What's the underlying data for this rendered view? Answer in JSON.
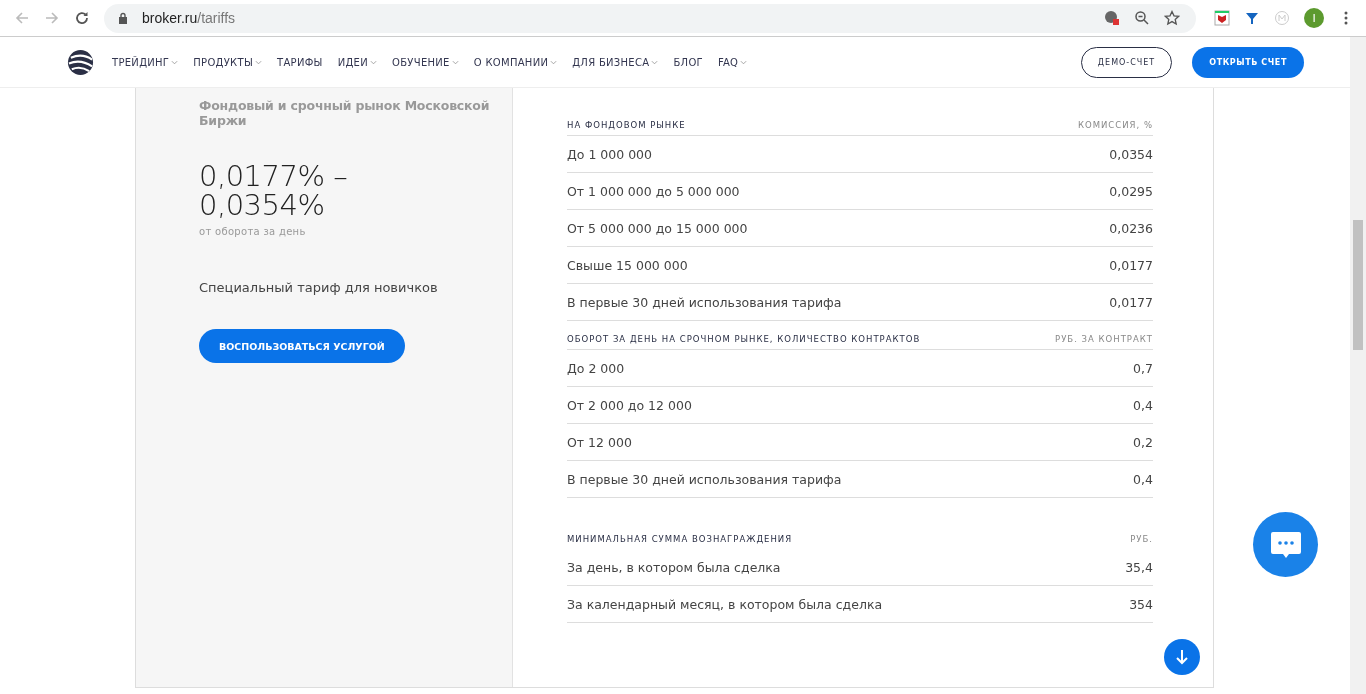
{
  "browser": {
    "url_host": "broker.ru",
    "url_path": "/tariffs",
    "profile_initial": "I"
  },
  "nav": {
    "items": [
      {
        "label": "ТРЕЙДИНГ",
        "dropdown": true
      },
      {
        "label": "ПРОДУКТЫ",
        "dropdown": true
      },
      {
        "label": "ТАРИФЫ",
        "dropdown": false
      },
      {
        "label": "ИДЕИ",
        "dropdown": true
      },
      {
        "label": "ОБУЧЕНИЕ",
        "dropdown": true
      },
      {
        "label": "О КОМПАНИИ",
        "dropdown": true
      },
      {
        "label": "ДЛЯ БИЗНЕСА",
        "dropdown": true
      },
      {
        "label": "БЛОГ",
        "dropdown": false
      },
      {
        "label": "FAQ",
        "dropdown": true
      }
    ],
    "demo_button": "ДЕМО-СЧЕТ",
    "open_button": "ОТКРЫТЬ СЧЕТ"
  },
  "tariff": {
    "market": "Фондовый и срочный рынок Московской Биржи",
    "rate_line_1": "0,0177% –",
    "rate_line_2": "0,0354%",
    "rate_note": "от оборота за день",
    "description": "Специальный тариф для новичков",
    "button": "ВОСПОЛЬЗОВАТЬСЯ УСЛУГОЙ"
  },
  "tables": [
    {
      "sections": [
        {
          "title": "НА ФОНДОВОМ РЫНКЕ",
          "unit": "КОМИССИЯ, %",
          "rows": [
            {
              "label": "До 1 000 000",
              "value": "0,0354"
            },
            {
              "label": "От 1 000 000 до 5 000 000",
              "value": "0,0295"
            },
            {
              "label": "От 5 000 000 до 15 000 000",
              "value": "0,0236"
            },
            {
              "label": "Свыше 15 000 000",
              "value": "0,0177"
            },
            {
              "label": "В первые 30 дней использования тарифа",
              "value": "0,0177"
            }
          ]
        },
        {
          "title": "ОБОРОТ ЗА ДЕНЬ НА СРОЧНОМ РЫНКЕ, КОЛИЧЕСТВО КОНТРАКТОВ",
          "unit": "РУБ. ЗА КОНТРАКТ",
          "rows": [
            {
              "label": "До 2 000",
              "value": "0,7"
            },
            {
              "label": "От 2 000 до 12 000",
              "value": "0,4"
            },
            {
              "label": "От 12 000",
              "value": "0,2"
            },
            {
              "label": "В первые 30 дней использования тарифа",
              "value": "0,4"
            }
          ]
        }
      ]
    },
    {
      "sections": [
        {
          "title": "МИНИМАЛЬНАЯ СУММА ВОЗНАГРАЖДЕНИЯ",
          "unit": "РУБ.",
          "rows": [
            {
              "label": "За день, в котором была сделка",
              "value": "35,4"
            },
            {
              "label": "За календарный месяц, в котором была сделка",
              "value": "354"
            }
          ]
        }
      ]
    }
  ]
}
